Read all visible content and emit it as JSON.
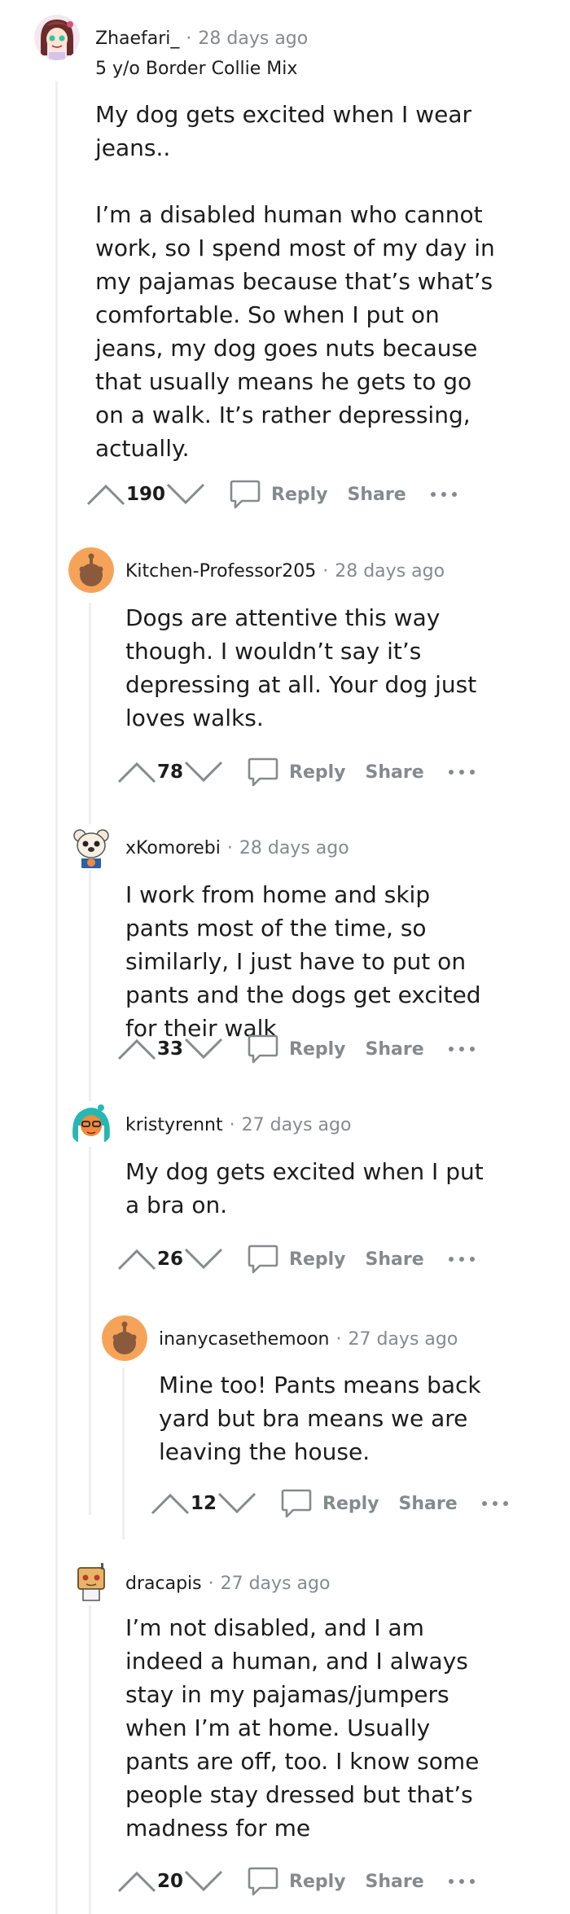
{
  "comments": [
    {
      "username": "Zhaefari_",
      "time": "28 days ago",
      "flair": "5 y/o Border Collie Mix",
      "paragraphs": [
        "My dog gets excited when I wear jeans..",
        "I’m a disabled human who cannot work, so I spend most of my day in my pajamas because that’s what’s comfortable. So when I put on jeans, my dog goes nuts because that usually means he gets to go on a walk. It’s rather depressing, actually."
      ],
      "score": "190",
      "avatar": "avatar-icon"
    },
    {
      "username": "Kitchen-Professor205",
      "time": "28 days ago",
      "paragraphs": [
        "Dogs are attentive this way though. I wouldn’t say it’s depressing at all. Your dog just loves walks."
      ],
      "score": "78",
      "avatar": "default-snoo-avatar-icon"
    },
    {
      "username": "xKomorebi",
      "time": "28 days ago",
      "paragraphs": [
        "I work from home and skip pants most of the time, so similarly, I just have to put on pants and the dogs get excited for their walk"
      ],
      "score": "33",
      "avatar": "polar-bear-avatar-icon"
    },
    {
      "username": "kristyrennt",
      "time": "27 days ago",
      "paragraphs": [
        "My dog gets excited when I put a bra on."
      ],
      "score": "26",
      "avatar": "teal-hair-avatar-icon"
    },
    {
      "username": "inanycasethemoon",
      "time": "27 days ago",
      "paragraphs": [
        "Mine too! Pants means back yard but bra means we are leaving the house."
      ],
      "score": "12",
      "avatar": "default-snoo-avatar-icon"
    },
    {
      "username": "dracapis",
      "time": "27 days ago",
      "paragraphs": [
        "I’m not disabled, and I am indeed a human, and I always stay in my pajamas/jumpers when I’m at home. Usually pants are off, too. I know some people stay dressed but that’s madness for me"
      ],
      "score": "20",
      "avatar": "box-head-avatar-icon"
    }
  ],
  "labels": {
    "reply": "Reply",
    "share": "Share"
  },
  "colors": {
    "meta_gray": "#878a8c",
    "thread_line": "#edeff1",
    "snoo_orange": "#f6a35a"
  }
}
